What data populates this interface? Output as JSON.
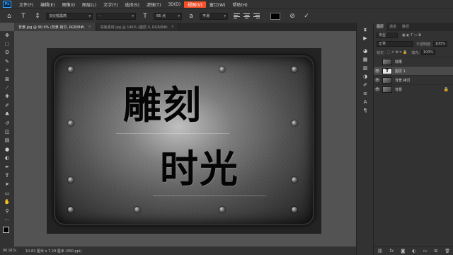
{
  "app": {
    "logo": "Ps"
  },
  "menu": [
    "文件(F)",
    "编辑(E)",
    "图像(I)",
    "图层(L)",
    "文字(Y)",
    "选择(S)",
    "滤镜(T)",
    "3D(D)",
    "视图(V)",
    "窗口(W)",
    "帮助(H)"
  ],
  "options": {
    "font_family": "汉仪锐黑简",
    "font_style": "-",
    "font_size": "66 点",
    "antialias": "平滑",
    "text_color": "#000000"
  },
  "tabs": [
    {
      "label": "背景.jpg @ 90.9% (背景 拷贝, RGB/8#)",
      "close": "×"
    },
    {
      "label": "铁板素材.jpg @ 146% (图层 0, RGB/8#)",
      "close": "×"
    }
  ],
  "canvas": {
    "line1": "雕刻",
    "line2": "时光"
  },
  "status": {
    "zoom": "90.91%",
    "doc": "10.82 厘米 x 7.29 厘米 (300 ppi)"
  },
  "panel": {
    "tabs": [
      "图层",
      "通道",
      "路径"
    ],
    "kind_label": "类型",
    "blend_mode": "正常",
    "opacity_label": "不透明度:",
    "opacity": "100%",
    "lock_label": "锁定:",
    "fill_label": "填充:",
    "fill": "100%",
    "layers": [
      {
        "name": "效果",
        "type": "image",
        "visible": false,
        "selected": false
      },
      {
        "name": "图层 1",
        "type": "text",
        "visible": true,
        "selected": true
      },
      {
        "name": "背景 拷贝",
        "type": "image",
        "visible": true,
        "selected": false
      },
      {
        "name": "背景",
        "type": "image",
        "visible": true,
        "selected": false,
        "locked": true
      }
    ]
  },
  "colors": {
    "accent": "#31a8ff",
    "active_menu": "#f4502a"
  }
}
